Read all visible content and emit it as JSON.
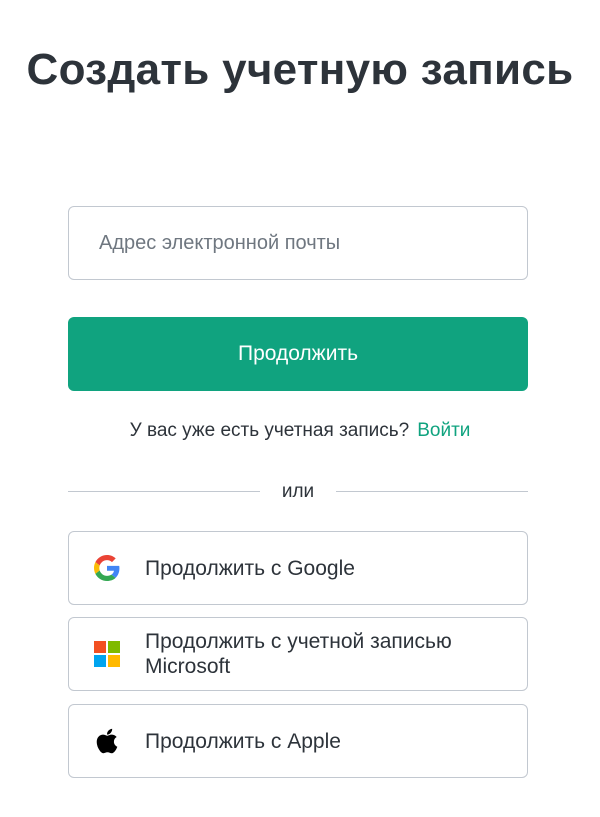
{
  "header": {
    "title": "Создать учетную запись"
  },
  "form": {
    "email_placeholder": "Адрес электронной почты",
    "continue_label": "Продолжить"
  },
  "login_prompt": {
    "text": "У вас уже есть учетная запись?",
    "link_label": "Войти"
  },
  "divider": {
    "label": "или"
  },
  "social": {
    "google_label": "Продолжить с Google",
    "microsoft_label": "Продолжить с учетной записью Microsoft",
    "apple_label": "Продолжить с Apple"
  },
  "colors": {
    "accent": "#10a37f",
    "text": "#2d333a",
    "border": "#c2c8d0"
  },
  "icons": {
    "google": "google-icon",
    "microsoft": "microsoft-icon",
    "apple": "apple-icon"
  }
}
